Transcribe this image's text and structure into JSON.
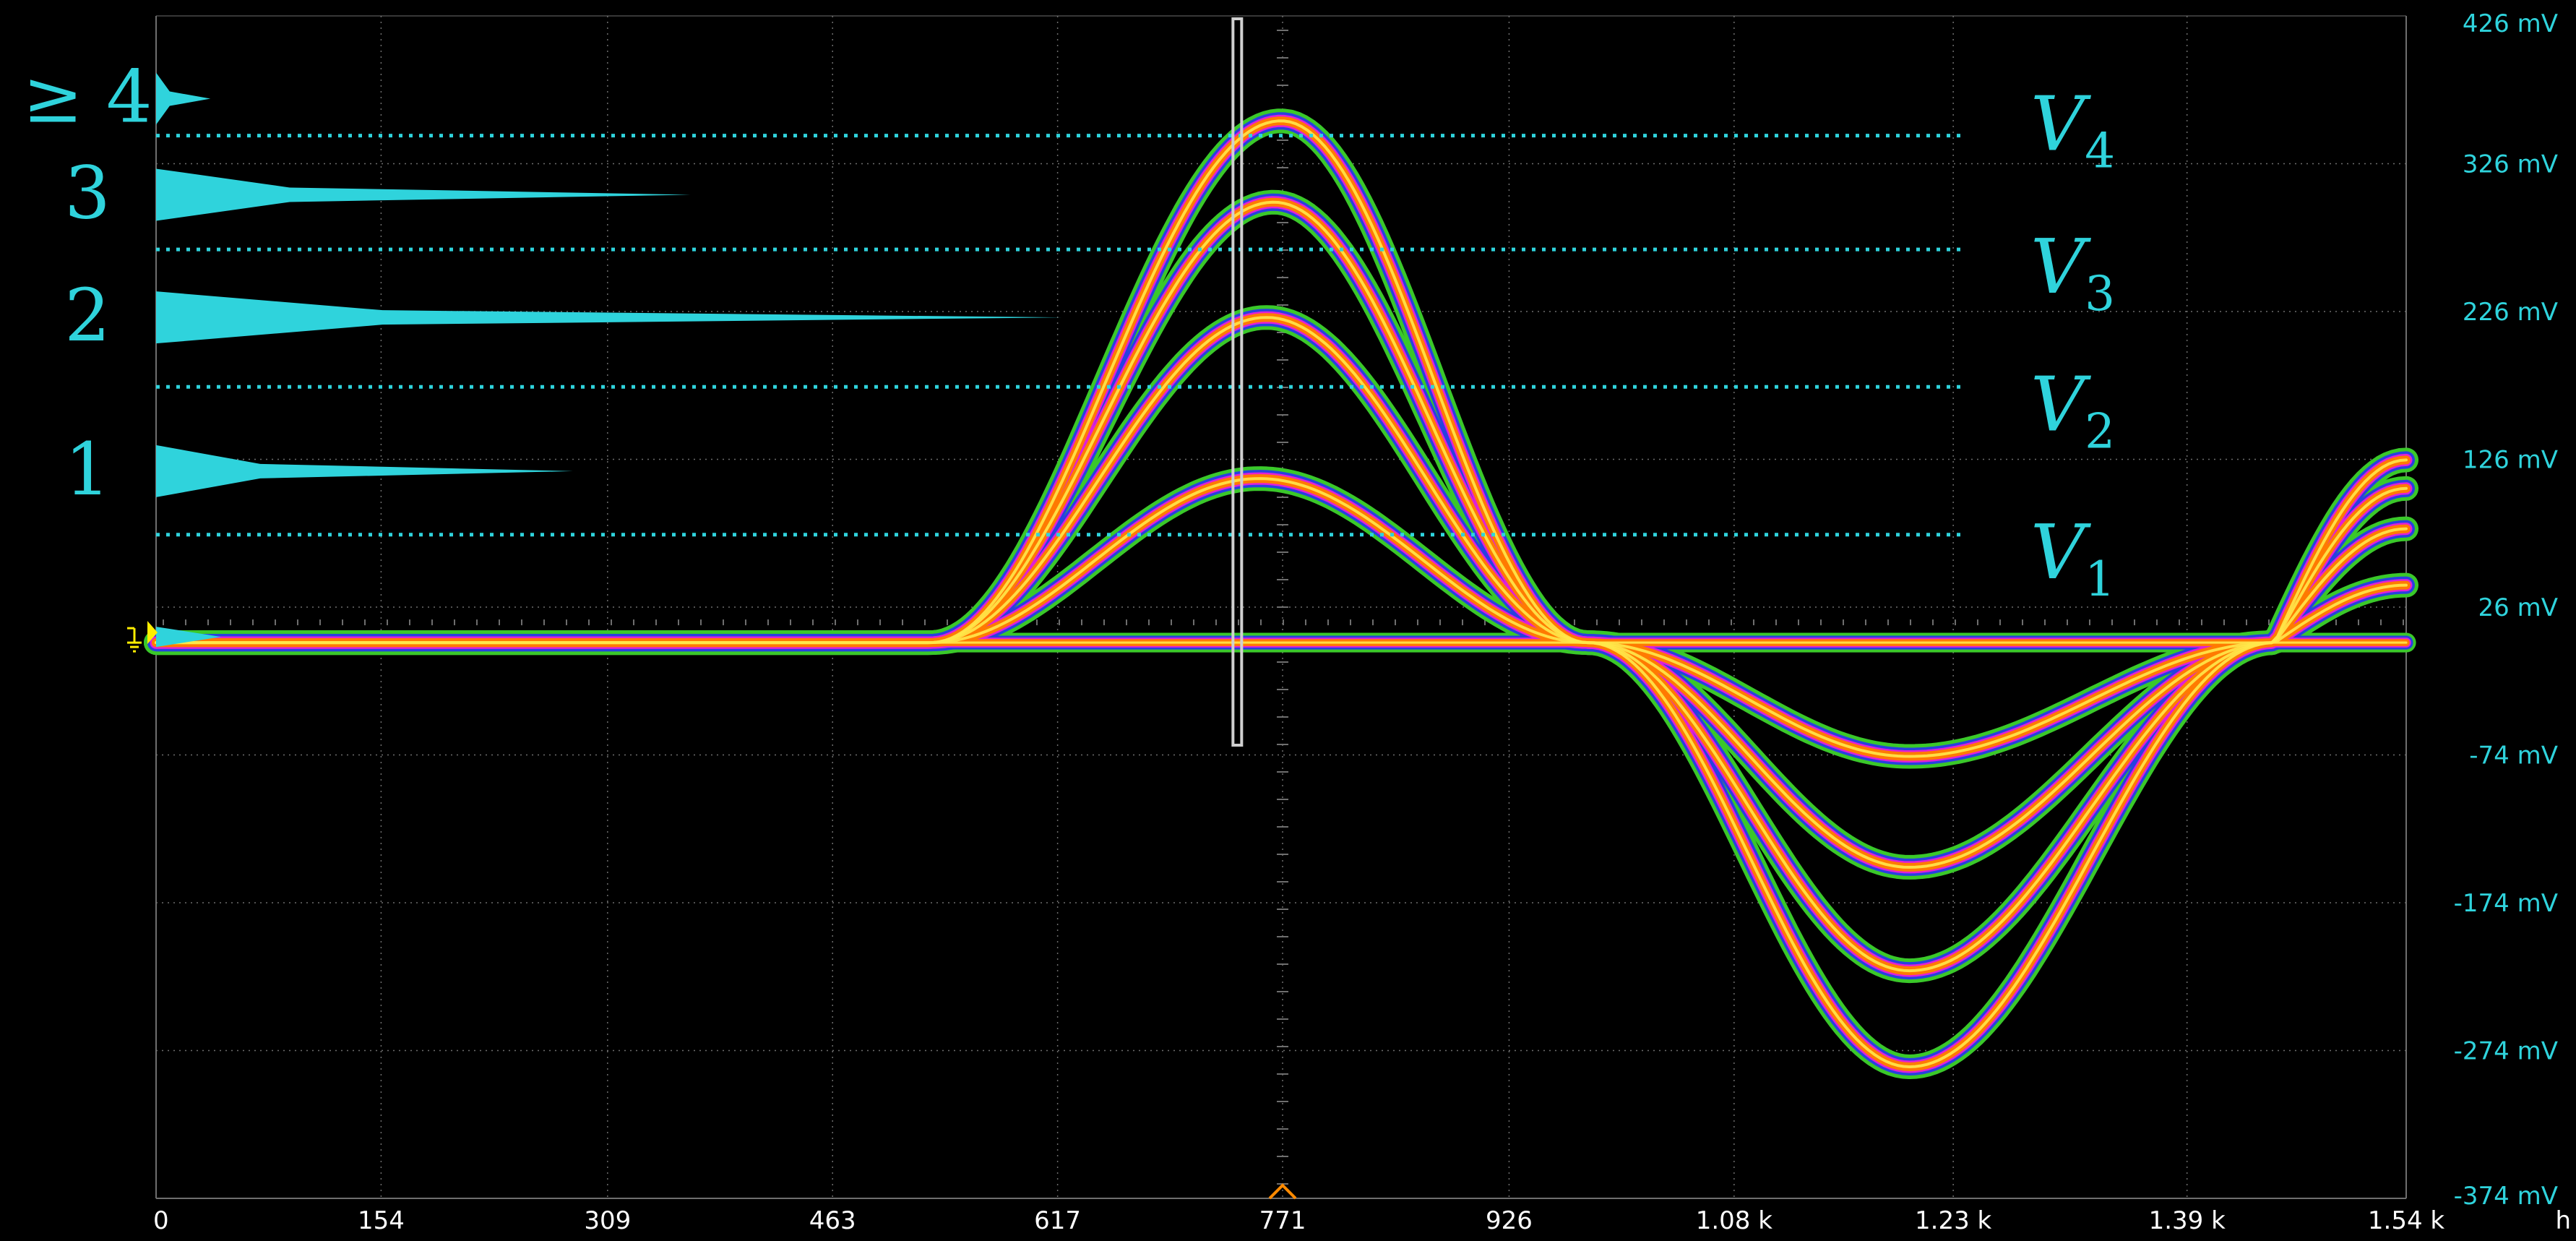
{
  "chart_data": {
    "type": "line",
    "title": "",
    "xlabel": "",
    "ylabel": "",
    "x_unit": "h",
    "y_unit": "mV",
    "xlim": [
      0,
      1540
    ],
    "ylim": [
      -374,
      426
    ],
    "grid": true,
    "x_ticks": [
      "0",
      "154",
      "309",
      "463",
      "617",
      "771",
      "926",
      "1.08 k",
      "1.23 k",
      "1.39 k",
      "1.54 k"
    ],
    "x_tick_values": [
      0,
      154,
      309,
      463,
      617,
      771,
      926,
      1080,
      1230,
      1390,
      1540
    ],
    "x_unit_label": "h",
    "y_ticks": [
      "426 mV",
      "326 mV",
      "226 mV",
      "126 mV",
      "26 mV",
      "-74 mV",
      "-174 mV",
      "-274 mV",
      "-374 mV"
    ],
    "y_tick_values": [
      426,
      326,
      226,
      126,
      26,
      -74,
      -174,
      -274,
      -374
    ],
    "baseline_mV": 2,
    "cursor_x": 740,
    "trigger_x": 771,
    "series": [
      {
        "peak_x": 755,
        "peak_mV": 113,
        "trough_x": 1200,
        "trough_mV": -75,
        "recovery_x": 1450
      },
      {
        "peak_x": 760,
        "peak_mV": 222,
        "trough_x": 1200,
        "trough_mV": -150,
        "recovery_x": 1450
      },
      {
        "peak_x": 765,
        "peak_mV": 300,
        "trough_x": 1200,
        "trough_mV": -220,
        "recovery_x": 1450
      },
      {
        "peak_x": 770,
        "peak_mV": 355,
        "trough_x": 1200,
        "trough_mV": -285,
        "recovery_x": 1450
      }
    ],
    "thresholds": [
      {
        "label": "V",
        "sub": "1",
        "value_mV": 75
      },
      {
        "label": "V",
        "sub": "2",
        "value_mV": 175
      },
      {
        "label": "V",
        "sub": "3",
        "value_mV": 268
      },
      {
        "label": "V",
        "sub": "4",
        "value_mV": 345
      }
    ],
    "histogram": [
      {
        "label": "1",
        "center_mV": 118,
        "count": 0.46
      },
      {
        "label": "2",
        "center_mV": 222,
        "count": 1.0
      },
      {
        "label": "3",
        "center_mV": 305,
        "count": 0.59
      },
      {
        "label": "≥ 4",
        "center_mV": 370,
        "count": 0.06
      }
    ],
    "colors": {
      "grid": "#6e6e6e",
      "threshold": "#2fd3dc",
      "histogram": "#2fd3dc",
      "persistence_outer": "#3ac82a",
      "persistence_blue": "#2740e0",
      "persistence_magenta": "#e020d8",
      "persistence_core": "#ff7a00",
      "persistence_hot": "#ffe84a",
      "trigger_marker": "#ff8a00",
      "ground_marker": "#ffee00",
      "cursor": "#d0d0d0"
    }
  }
}
